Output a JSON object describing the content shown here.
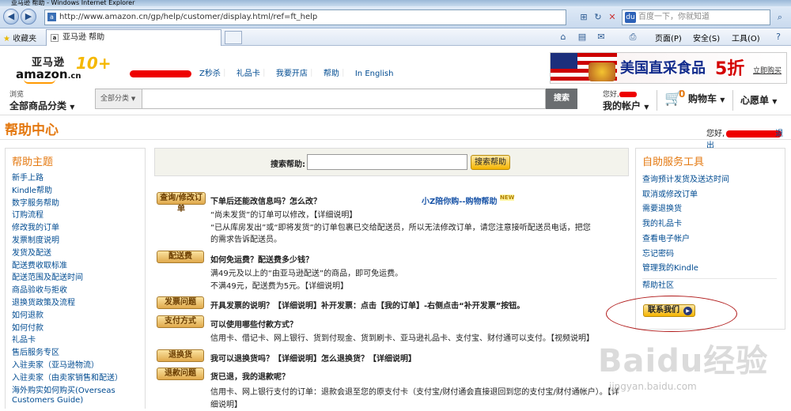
{
  "browser": {
    "window_title": "亚马逊 帮助 - Windows Internet Explorer",
    "url": "http://www.amazon.cn/gp/help/customer/display.html/ref=ft_help",
    "search_placeholder": "百度一下，你就知道",
    "favorites_label": "收藏夹",
    "tab_title": "亚马逊 帮助",
    "commands": [
      "页面(P)",
      "安全(S)",
      "工具(O)"
    ]
  },
  "header": {
    "logo_cn": "亚马逊",
    "logo_en": "amazon",
    "logo_suffix": ".cn",
    "anniversary": "10+",
    "links": [
      "Z秒杀",
      "礼品卡",
      "我要开店",
      "帮助",
      "In English"
    ],
    "promo_text": "美国直采食品",
    "promo_discount": "5折",
    "promo_link": "立即购买"
  },
  "search_row": {
    "browse_small": "浏览",
    "browse_label": "全部商品分类",
    "category": "全部分类",
    "search_button": "搜索",
    "account_small": "您好,",
    "account_label": "我的帐户",
    "cart_count": "0",
    "cart_label": "购物车",
    "wishlist_label": "心愿单"
  },
  "page": {
    "title": "帮助中心",
    "greeting": "您好,",
    "signout": "退出"
  },
  "left_nav": {
    "heading": "帮助主题",
    "items": [
      "新手上路",
      "Kindle帮助",
      "数字服务帮助",
      "订购流程",
      "修改我的订单",
      "发票制度说明",
      "发货及配送",
      "配送费收取标准",
      "配送范围及配送时间",
      "商品验收与拒收",
      "退换货政策及流程",
      "如何退款",
      "如何付款",
      "礼品卡",
      "售后服务专区",
      "入驻卖家（亚马逊物流）",
      "入驻卖家（由卖家销售和配送）",
      "海外购实如何购买(Overseas Customers Guide)"
    ]
  },
  "search_help": {
    "label": "搜索帮助:",
    "button": "搜索帮助"
  },
  "promo_link": {
    "text": "小Z陪你购--购物帮助",
    "badge": "NEW"
  },
  "faq": [
    {
      "tag": "查询/修改订单",
      "question": "下单后还能改信息吗？怎么改？",
      "lines": [
        "“尚未发货”的订单可以修改，【详细说明】",
        "“已从库房发出”或“即将发货”的订单包裹已交给配送员，所以无法修改订单，请您注意接听配送员电话，把您的需求告诉配送员。"
      ]
    },
    {
      "tag": "配送费",
      "question": "如何免运费？配送费多少钱？",
      "lines": [
        "满49元及以上的“由亚马逊配送”的商品，即可免运费。",
        "不满49元，配送费为5元。【详细说明】"
      ]
    },
    {
      "tag": "发票问题",
      "question": "开具发票的说明？【详细说明】补开发票：点击【我的订单】-右侧点击“补开发票”按钮。",
      "lines": []
    },
    {
      "tag": "支付方式",
      "question": "可以使用哪些付款方式？",
      "lines": [
        "信用卡、借记卡、网上银行、货到付现金、货到刷卡、亚马逊礼品卡、支付宝、财付通可以支付。【视频说明】"
      ]
    },
    {
      "tag": "退换货",
      "question": "我可以退换货吗？【详细说明】怎么退换货？【详细说明】",
      "lines": []
    },
    {
      "tag": "退款问题",
      "question": "货已退，我的退款呢？",
      "lines": [
        "信用卡、网上银行支付的订单：退款会退至您的原支付卡（支付宝/财付通会直接退回到您的支付宝/财付通帐户）。【详细说明】"
      ]
    }
  ],
  "right_box": {
    "heading": "自助服务工具",
    "items": [
      "查询预计发货及送达时间",
      "取消或修改订单",
      "需要退换货",
      "我的礼品卡",
      "查看电子帐户",
      "忘记密码",
      "管理我的Kindle"
    ],
    "community": "帮助社区",
    "contact_button": "联系我们"
  },
  "watermark": {
    "brand": "Baidu经验",
    "url": "jingyan.baidu.com"
  },
  "colors": {
    "accent": "#e47911",
    "link": "#004b91",
    "annotation": "#b01818"
  }
}
